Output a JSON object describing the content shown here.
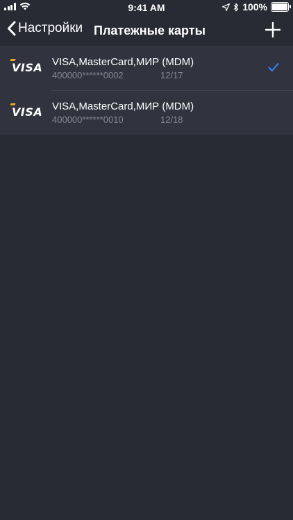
{
  "status_bar": {
    "time": "9:41 AM",
    "battery": "100%",
    "battery_level": 1.0,
    "icons": [
      "signal-icon",
      "wifi-icon",
      "location-icon",
      "bluetooth-icon",
      "battery-icon"
    ]
  },
  "nav": {
    "back_label": "Настройки",
    "title": "Платежные карты",
    "back_icon": "chevron-left-icon",
    "add_icon": "plus-icon"
  },
  "cards": [
    {
      "brand": "VISA",
      "name": "VISA,MasterCard,МИР (MDM)",
      "number": "400000******0002",
      "expiry": "12/17",
      "selected": true
    },
    {
      "brand": "VISA",
      "name": "VISA,MasterCard,МИР (MDM)",
      "number": "400000******0010",
      "expiry": "12/18",
      "selected": false
    }
  ],
  "colors": {
    "background": "#282a34",
    "row_background": "#31333e",
    "secondary_text": "#868895",
    "accent": "#2e86ff",
    "visa_gold": "#f0a324"
  }
}
